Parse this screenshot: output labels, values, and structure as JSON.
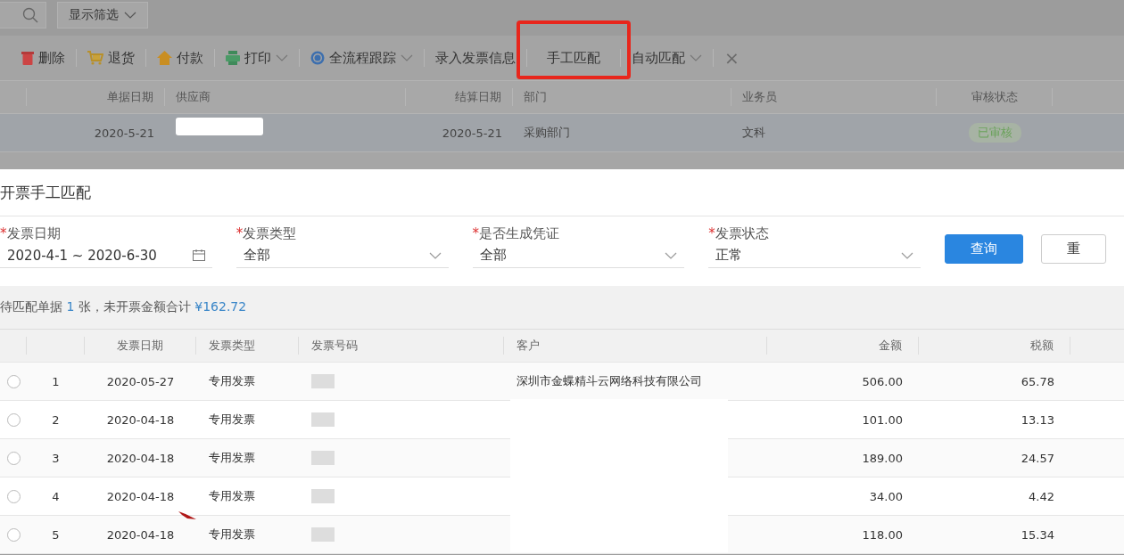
{
  "topbar": {
    "filter_button": "显示筛选"
  },
  "toolbar": [
    {
      "label": "删除",
      "kind": "delete",
      "dropdown": false,
      "highlighted": false
    },
    {
      "label": "退货",
      "kind": "return",
      "dropdown": false,
      "highlighted": false
    },
    {
      "label": "付款",
      "kind": "payment",
      "dropdown": false,
      "highlighted": false
    },
    {
      "label": "打印",
      "kind": "print",
      "dropdown": true,
      "highlighted": false
    },
    {
      "label": "全流程跟踪",
      "kind": "trace",
      "dropdown": true,
      "highlighted": false
    },
    {
      "label": "录入发票信息",
      "kind": "plain",
      "dropdown": false,
      "highlighted": false
    },
    {
      "label": "手工匹配",
      "kind": "plain",
      "dropdown": false,
      "highlighted": true
    },
    {
      "label": "自动匹配",
      "kind": "plain",
      "dropdown": true,
      "highlighted": false
    },
    {
      "label": "×",
      "kind": "close",
      "dropdown": false,
      "highlighted": false
    }
  ],
  "background_table": {
    "columns": [
      "单据日期",
      "供应商",
      "结算日期",
      "部门",
      "业务员",
      "审核状态"
    ],
    "rows": [
      [
        {
          "kind": "text",
          "text": "2020-5-21"
        },
        {
          "kind": "redacted"
        },
        {
          "kind": "text",
          "text": "2020-5-21"
        },
        {
          "kind": "text",
          "text": "采购部门"
        },
        {
          "kind": "text",
          "text": "文科"
        },
        {
          "kind": "tag",
          "text": "已审核"
        }
      ]
    ]
  },
  "dialog": {
    "title": "开票手工匹配",
    "filters": [
      {
        "mark": "*",
        "label": "发票日期",
        "value": "2020-4-1 ~ 2020-6-30",
        "kind": "date"
      },
      {
        "mark": "*",
        "label": "发票类型",
        "value": "全部",
        "kind": "select"
      },
      {
        "mark": "*",
        "label": "是否生成凭证",
        "value": "全部",
        "kind": "select"
      },
      {
        "mark": "*",
        "label": "发票状态",
        "value": "正常",
        "kind": "select"
      }
    ],
    "buttons": [
      {
        "label": "查询",
        "primary": true
      },
      {
        "label": "重",
        "primary": false
      }
    ],
    "summary": {
      "prefix": "待匹配单据",
      "count": "1",
      "middle": "张，未开票金额合计",
      "amount": "¥162.72"
    },
    "table": {
      "columns": [
        "发票日期",
        "发票类型",
        "发票号码",
        "客户",
        "金额",
        "税额"
      ],
      "rows": [
        {
          "selected": false,
          "index": "1",
          "date": "2020-05-27",
          "type": "专用发票",
          "number": {
            "kind": "redacted"
          },
          "customer": {
            "kind": "text",
            "text": "深圳市金蝶精斗云网络科技有限公司"
          },
          "amount": "506.00",
          "tax": "65.78"
        },
        {
          "selected": false,
          "index": "2",
          "date": "2020-04-18",
          "type": "专用发票",
          "number": {
            "kind": "redacted"
          },
          "customer": {
            "kind": "redacted"
          },
          "amount": "101.00",
          "tax": "13.13"
        },
        {
          "selected": false,
          "index": "3",
          "date": "2020-04-18",
          "type": "专用发票",
          "number": {
            "kind": "redacted"
          },
          "customer": {
            "kind": "redacted"
          },
          "amount": "189.00",
          "tax": "24.57"
        },
        {
          "selected": false,
          "index": "4",
          "date": "2020-04-18",
          "type": "专用发票",
          "number": {
            "kind": "redacted"
          },
          "customer": {
            "kind": "redacted"
          },
          "amount": "34.00",
          "tax": "4.42"
        },
        {
          "selected": false,
          "index": "5",
          "date": "2020-04-18",
          "type": "专用发票",
          "number": {
            "kind": "redacted"
          },
          "customer": {
            "kind": "redacted"
          },
          "amount": "118.00",
          "tax": "15.34"
        }
      ]
    }
  }
}
